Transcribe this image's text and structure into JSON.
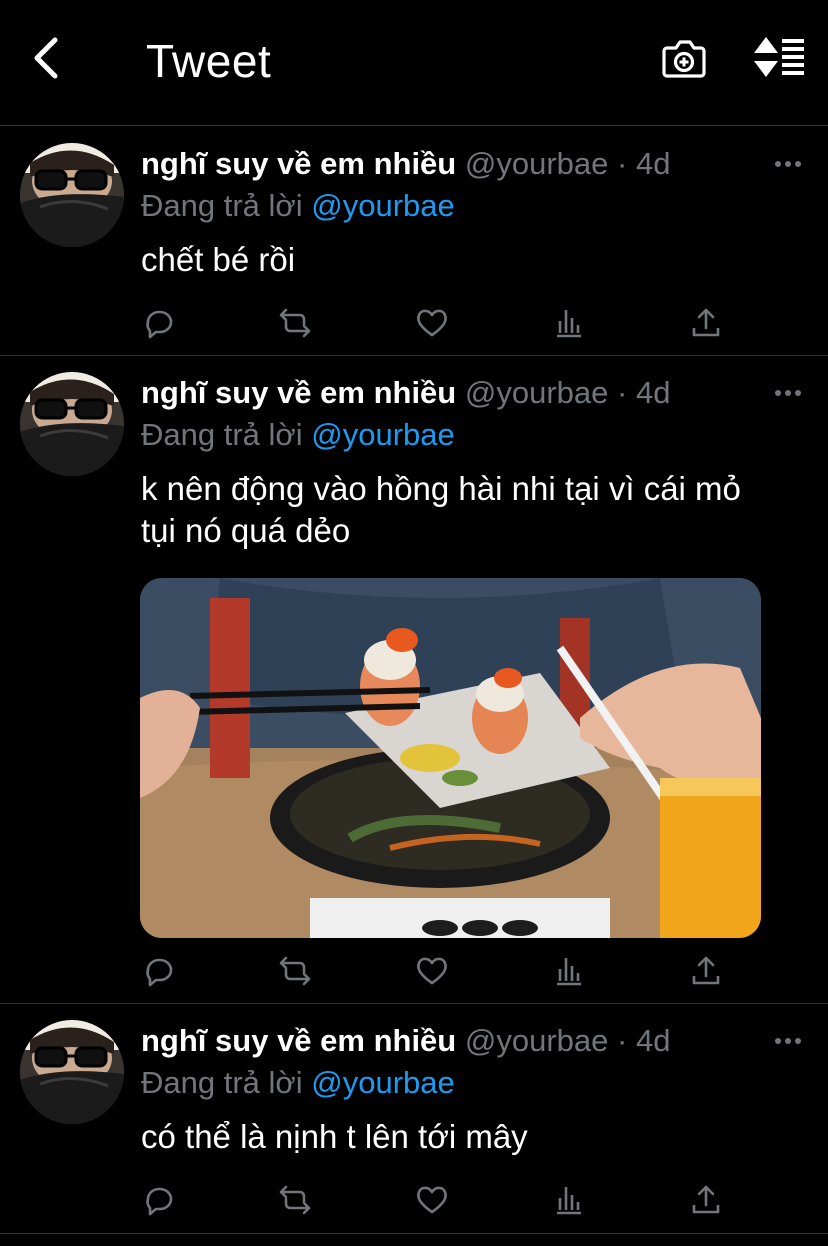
{
  "header": {
    "title": "Tweet",
    "back_icon": "chevron-left-icon",
    "camera_icon": "camera-icon",
    "sort_icon": "sort-icon"
  },
  "colors": {
    "background": "#000000",
    "text": "#ffffff",
    "muted": "#71767b",
    "link": "#1d9bf0",
    "divider": "#2f3336"
  },
  "tweets": [
    {
      "name": "nghĩ suy về em nhiều",
      "handle": "@yourbae",
      "dot": "·",
      "time": "4d",
      "reply_prefix": "Đang trả lời",
      "reply_to": "@yourbae",
      "text": "chết bé rồi",
      "has_image": false
    },
    {
      "name": "nghĩ suy về em nhiều",
      "handle": "@yourbae",
      "dot": "·",
      "time": "4d",
      "reply_prefix": "Đang trả lời",
      "reply_to": "@yourbae",
      "text": "k nên động vào hồng hài nhi tại vì cái mỏ tụi nó quá dẻo",
      "has_image": true
    },
    {
      "name": "nghĩ suy về em nhiều",
      "handle": "@yourbae",
      "dot": "·",
      "time": "4d",
      "reply_prefix": "Đang trả lời",
      "reply_to": "@yourbae",
      "text": "có thể là nịnh t lên tới mây",
      "has_image": false
    }
  ],
  "action_icons": [
    "reply-icon",
    "retweet-icon",
    "like-icon",
    "views-icon",
    "share-icon"
  ]
}
